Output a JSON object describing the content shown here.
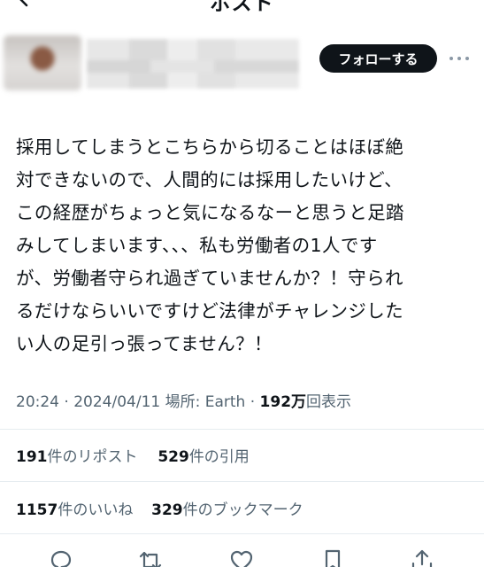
{
  "header": {
    "title": "ポスト"
  },
  "author": {
    "follow_label": "フォローする"
  },
  "tweet": {
    "text": "採用してしまうとこちらから切ることはほぼ絶\n対できないので、人間的には採用したいけど、\nこの経歴がちょっと気になるなーと思うと足踏\nみしてしまいます、、、私も労働者の1人です\nが、労働者守られ過ぎていませんか？！守られ\nるだけならいいですけど法律がチャレンジした\nい人の足引っ張ってません？！"
  },
  "meta": {
    "time": "20:24",
    "sep1": " · ",
    "date": "2024/04/11",
    "location": " 場所: Earth",
    "sep2": " · ",
    "views": "192万",
    "views_label": "回表示"
  },
  "stats": {
    "reposts": "191",
    "reposts_label": "件のリポスト",
    "quotes": "529",
    "quotes_label": "件の引用",
    "likes": "1157",
    "likes_label": "件のいいね",
    "bookmarks": "329",
    "bookmarks_label": "件のブックマーク"
  },
  "icons": {
    "back": "back-arrow-icon",
    "more": "more-icon",
    "reply": "reply-icon",
    "repost": "repost-icon",
    "like": "like-icon",
    "bookmark": "bookmark-icon",
    "share": "share-icon"
  },
  "colors": {
    "text": "#0f1419",
    "secondary": "#536471",
    "button_bg": "#0f1419",
    "divider": "#e6ecf0"
  }
}
